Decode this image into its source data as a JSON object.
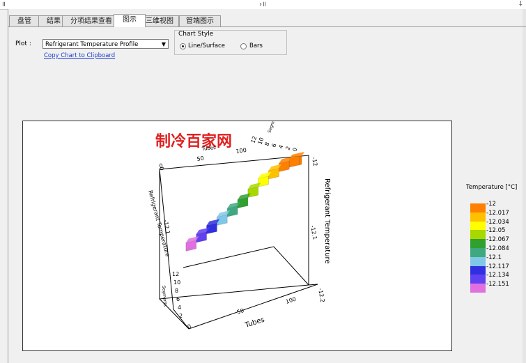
{
  "topbar": {
    "glyphs": [
      "॥",
      "›॥",
      "⸸"
    ]
  },
  "tabs": [
    {
      "label": "盘管",
      "name": "tab-coil"
    },
    {
      "label": "结果",
      "name": "tab-results"
    },
    {
      "label": "分项结果查看",
      "name": "tab-itemized-results"
    },
    {
      "label": "图示",
      "name": "tab-chart",
      "active": true
    },
    {
      "label": "三维视图",
      "name": "tab-3d-view"
    },
    {
      "label": "管端图示",
      "name": "tab-tube-end-chart"
    }
  ],
  "plot": {
    "label": "Plot :",
    "selected": "Refrigerant Temperature Profile",
    "copy_link": "Copy Chart to Clipboard"
  },
  "chart_style": {
    "title": "Chart Style",
    "options": [
      {
        "label": "Line/Surface",
        "selected": true
      },
      {
        "label": "Bars",
        "selected": false
      }
    ]
  },
  "watermark": "制冷百家网",
  "chart_data": {
    "type": "area",
    "zlabel": "Refrigerant Temperature",
    "zlabel_left": "Refrigerant Temperature",
    "xlabel": "Tubes",
    "ylabel": "Segments",
    "x_ticks_front": [
      "0",
      "50",
      "100"
    ],
    "x_ticks_back": [
      "0",
      "50",
      "100"
    ],
    "z_ticks_right": [
      "-12",
      "-12.1",
      "-12.2"
    ],
    "z_ticks_left": [
      "0",
      "-12.1"
    ],
    "y_ticks_front": [
      "2",
      "4",
      "6",
      "8",
      "10",
      "12"
    ],
    "y_ticks_back": [
      "0",
      "2",
      "4",
      "6",
      "8",
      "10",
      "12"
    ],
    "zlim": [
      -12.2,
      -12
    ],
    "xlim": [
      0,
      120
    ],
    "color_scale_values": [
      -12,
      -12.017,
      -12.034,
      -12.05,
      -12.067,
      -12.084,
      -12.1,
      -12.117,
      -12.134,
      -12.151
    ],
    "steps": [
      {
        "tube_start": 118,
        "tube_end": 120,
        "temp": -12.0
      },
      {
        "tube_start": 108,
        "tube_end": 118,
        "temp": -12.0
      },
      {
        "tube_start": 98,
        "tube_end": 108,
        "temp": -12.005
      },
      {
        "tube_start": 88,
        "tube_end": 98,
        "temp": -12.017
      },
      {
        "tube_start": 78,
        "tube_end": 88,
        "temp": -12.03
      },
      {
        "tube_start": 68,
        "tube_end": 78,
        "temp": -12.05
      },
      {
        "tube_start": 58,
        "tube_end": 68,
        "temp": -12.07
      },
      {
        "tube_start": 48,
        "tube_end": 58,
        "temp": -12.085
      },
      {
        "tube_start": 38,
        "tube_end": 48,
        "temp": -12.1
      },
      {
        "tube_start": 28,
        "tube_end": 38,
        "temp": -12.115
      },
      {
        "tube_start": 18,
        "tube_end": 28,
        "temp": -12.13
      },
      {
        "tube_start": 8,
        "tube_end": 18,
        "temp": -12.145
      }
    ]
  },
  "legend": {
    "title": "Temperature [°C]",
    "items": [
      {
        "label": "-12",
        "color": "#ff8000"
      },
      {
        "label": "-12.017",
        "color": "#ffc000"
      },
      {
        "label": "-12.034",
        "color": "#ffff00"
      },
      {
        "label": "-12.05",
        "color": "#a8d800"
      },
      {
        "label": "-12.067",
        "color": "#30a030"
      },
      {
        "label": "-12.084",
        "color": "#40a880"
      },
      {
        "label": "-12.1",
        "color": "#80c8e8"
      },
      {
        "label": "-12.117",
        "color": "#3030e0"
      },
      {
        "label": "-12.134",
        "color": "#6040f0"
      },
      {
        "label": "-12.151",
        "color": "#e070e0"
      }
    ]
  }
}
